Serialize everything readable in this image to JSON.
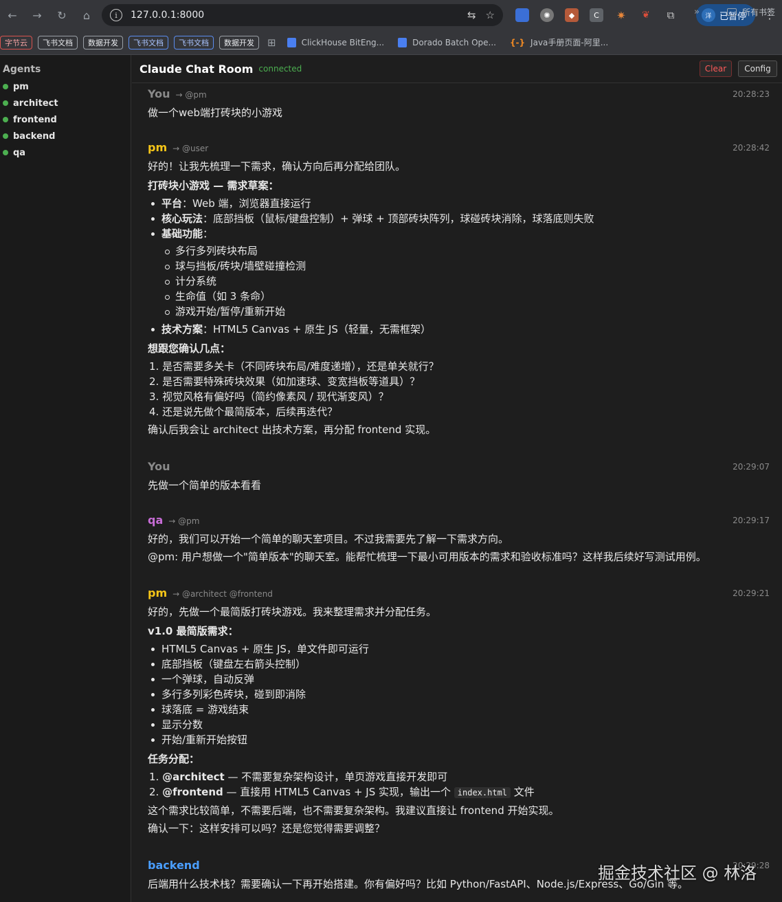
{
  "browser": {
    "url": "127.0.0.1:8000",
    "paused_label": "已暂停",
    "paused_avatar": "洋",
    "bookmarks": [
      "字节云",
      "飞书文档",
      "数据开发",
      "飞书文档",
      "飞书文档",
      "数据开发"
    ],
    "links": [
      "ClickHouse BitEng...",
      "Dorado Batch Ope...",
      "Java手册页面-阿里..."
    ],
    "all_bookmarks": "所有书签"
  },
  "sidebar": {
    "title": "Agents",
    "agents": [
      "pm",
      "architect",
      "frontend",
      "backend",
      "qa"
    ]
  },
  "header": {
    "title": "Claude Chat Room",
    "status": "connected",
    "clear_label": "Clear",
    "config_label": "Config"
  },
  "messages": [
    {
      "sender": "You",
      "to": "→ @pm",
      "time": "20:28:23",
      "text": "做一个web端打砖块的小游戏"
    },
    {
      "sender": "pm",
      "to": "→ @user",
      "time": "20:28:42",
      "intro": "好的！让我先梳理一下需求，确认方向后再分配给团队。",
      "heading": "打砖块小游戏 — 需求草案：",
      "items": [
        {
          "k": "平台",
          "v": "：Web 端，浏览器直接运行"
        },
        {
          "k": "核心玩法",
          "v": "：底部挡板（鼠标/键盘控制）+ 弹球 + 顶部砖块阵列，球碰砖块消除，球落底则失败"
        },
        {
          "k": "基础功能",
          "v": "："
        }
      ],
      "sub": [
        "多行多列砖块布局",
        "球与挡板/砖块/墙壁碰撞检测",
        "计分系统",
        "生命值（如 3 条命）",
        "游戏开始/暂停/重新开始"
      ],
      "tech": {
        "k": "技术方案",
        "v": "：HTML5 Canvas + 原生 JS（轻量，无需框架）"
      },
      "confirm_heading": "想跟您确认几点：",
      "questions": [
        "1. 是否需要多关卡（不同砖块布局/难度递增），还是单关就行？",
        "2. 是否需要特殊砖块效果（如加速球、变宽挡板等道具）？",
        "3. 视觉风格有偏好吗（简约像素风 / 现代渐变风）？",
        "4. 还是说先做个最简版本，后续再迭代？"
      ],
      "outro": "确认后我会让 architect 出技术方案，再分配 frontend 实现。"
    },
    {
      "sender": "You",
      "to": "",
      "time": "20:29:07",
      "text": "先做一个简单的版本看看"
    },
    {
      "sender": "qa",
      "to": "→ @pm",
      "time": "20:29:17",
      "line1": "好的，我们可以开始一个简单的聊天室项目。不过我需要先了解一下需求方向。",
      "line2": "@pm: 用户想做一个\"简单版本\"的聊天室。能帮忙梳理一下最小可用版本的需求和验收标准吗？这样我后续好写测试用例。"
    },
    {
      "sender": "pm",
      "to": "→ @architect @frontend",
      "time": "20:29:21",
      "intro": "好的，先做一个最简版打砖块游戏。我来整理需求并分配任务。",
      "heading": "v1.0 最简版需求：",
      "items": [
        "HTML5 Canvas + 原生 JS，单文件即可运行",
        "底部挡板（键盘左右箭头控制）",
        "一个弹球，自动反弹",
        "多行多列彩色砖块，碰到即消除",
        "球落底 = 游戏结束",
        "显示分数",
        "开始/重新开始按钮"
      ],
      "assign_heading": "任务分配：",
      "assign1_num": "1. ",
      "assign1_k": "@architect",
      "assign1_v": " — 不需要复杂架构设计，单页游戏直接开发即可",
      "assign2_num": "2. ",
      "assign2_k": "@frontend",
      "assign2_v": " — 直接用 HTML5 Canvas + JS 实现，输出一个 ",
      "assign2_code": "index.html",
      "assign2_tail": " 文件",
      "line_a": "这个需求比较简单，不需要后端，也不需要复杂架构。我建议直接让 frontend 开始实现。",
      "line_b": "确认一下：这样安排可以吗？还是您觉得需要调整？"
    },
    {
      "sender": "backend",
      "to": "",
      "time": "20:29:28",
      "text": "后端用什么技术栈？需要确认一下再开始搭建。你有偏好吗？比如 Python/FastAPI、Node.js/Express、Go/Gin 等。"
    }
  ],
  "watermark": "掘金技术社区 @ 林洛"
}
